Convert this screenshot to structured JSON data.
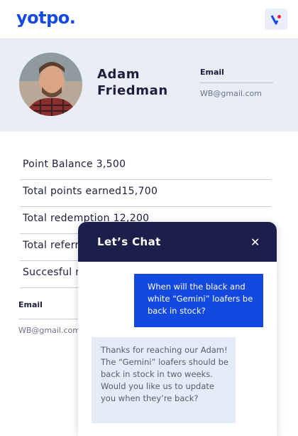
{
  "header": {
    "logo_text": "yotpo.",
    "brand_color": "#1649e6",
    "app_icon": "v-heart-icon"
  },
  "profile": {
    "name": "Adam Friedman",
    "email_label": "Email",
    "email_value": "WB@gmail.com",
    "background": "#e8edf6"
  },
  "stats": [
    {
      "label": "Point Balance 3,500"
    },
    {
      "label": "Total points earned15,700"
    },
    {
      "label": "Total redemption 12,200"
    },
    {
      "label": "Total referr"
    },
    {
      "label": "Succesful r"
    }
  ],
  "lower_email": {
    "label": "Email",
    "value": "WB@gmail.com"
  },
  "chat": {
    "title": "Let’s Chat",
    "close_icon": "close-icon",
    "header_color": "#1c1f4a",
    "messages": [
      {
        "from": "user",
        "text": "When will the black and white “Gemini” loafers be back in stock?"
      },
      {
        "from": "bot",
        "text": "Thanks for reaching our Adam! The “Gemini” loafers should be back in stock in two weeks. Would you like us to update you when they’re back?"
      }
    ]
  }
}
